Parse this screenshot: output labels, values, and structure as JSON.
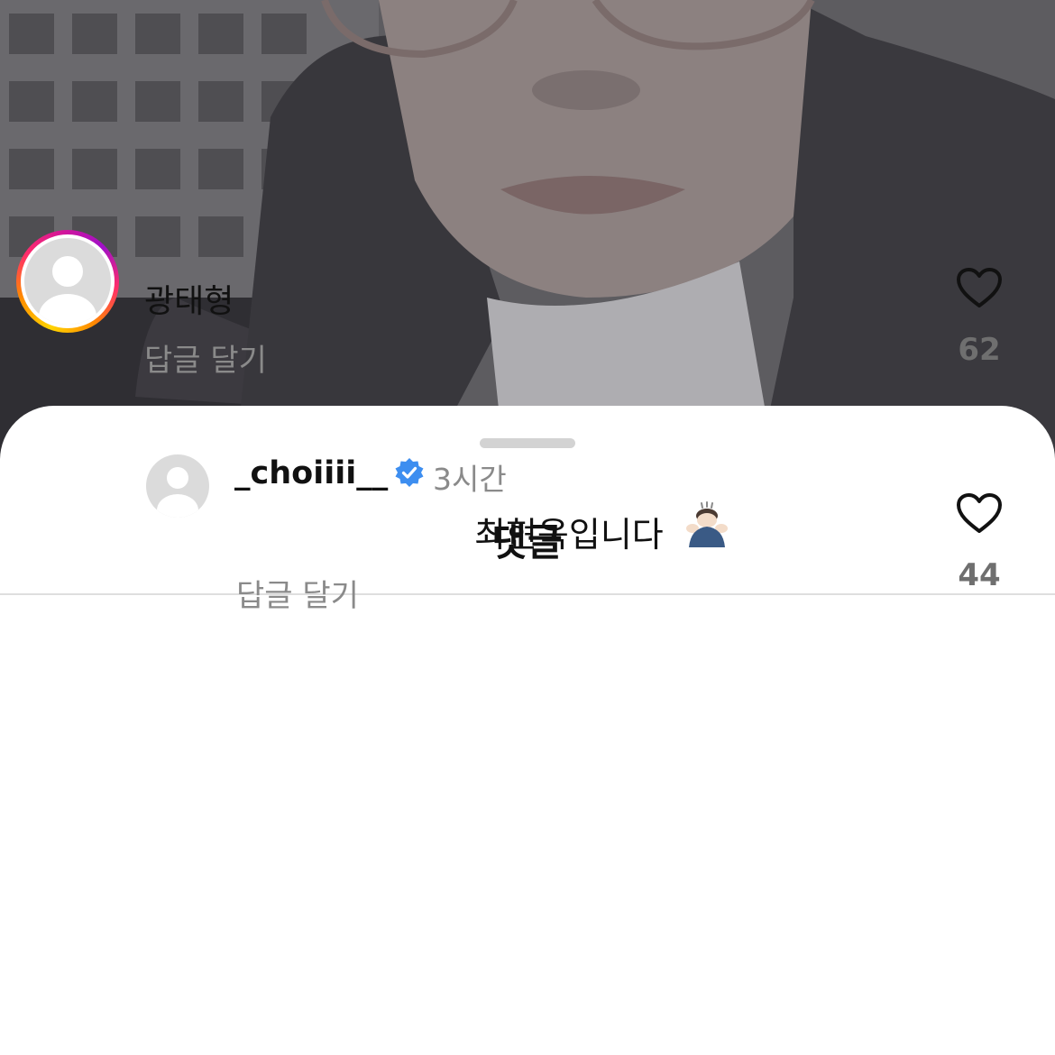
{
  "sheet": {
    "title": "댓글"
  },
  "comments": [
    {
      "username": "광태형",
      "reply_label": "답글 달기",
      "likes": "62",
      "avatar": "default-avatar-icon",
      "has_story_ring": true
    }
  ],
  "replies": [
    {
      "username": "_choiiii__",
      "verified": true,
      "time": "3시간",
      "text": "최현욱입니다",
      "emoji": "person-bowing-emoji",
      "reply_label": "답글 달기",
      "likes": "44",
      "avatar": "default-avatar-icon"
    }
  ],
  "colors": {
    "verified_badge": "#3d8ef0",
    "secondary_text": "#8a8a8a",
    "divider": "#dedede"
  }
}
